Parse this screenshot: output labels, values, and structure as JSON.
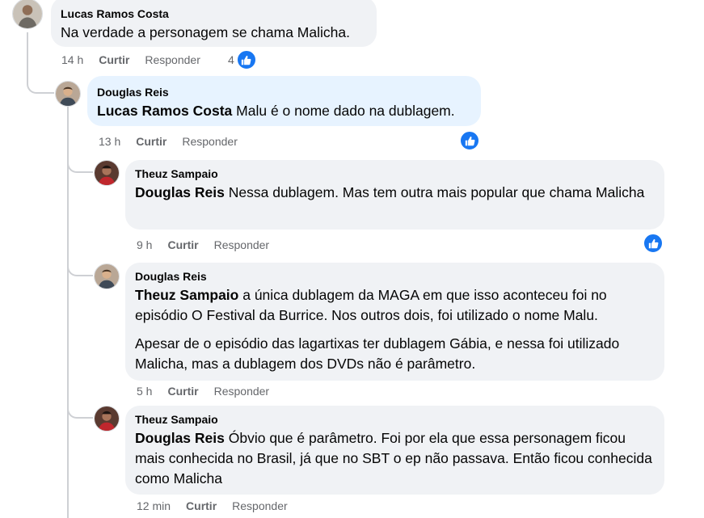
{
  "comments": [
    {
      "author": "Lucas Ramos Costa",
      "mention": "",
      "text": "Na verdade a personagem se chama Malicha.",
      "time": "14 h",
      "like_label": "Curtir",
      "reply_label": "Responder",
      "reaction_count": "4"
    },
    {
      "author": "Douglas Reis",
      "mention": "Lucas Ramos Costa",
      "text": "Malu é o nome dado na dublagem.",
      "time": "13 h",
      "like_label": "Curtir",
      "reply_label": "Responder"
    },
    {
      "author": "Theuz Sampaio",
      "mention": "Douglas Reis",
      "text": "Nessa dublagem. Mas tem outra mais popular que chama Malicha",
      "time": "9 h",
      "like_label": "Curtir",
      "reply_label": "Responder"
    },
    {
      "author": "Douglas Reis",
      "mention": "Theuz Sampaio",
      "text": "a única dublagem da MAGA em que isso aconteceu foi no episódio O Festival da Burrice. Nos outros dois, foi utilizado o nome Malu.",
      "text2": "Apesar de o episódio das lagartixas ter dublagem Gábia, e nessa foi utilizado Malicha, mas a dublagem dos DVDs não é parâmetro.",
      "time": "5 h",
      "like_label": "Curtir",
      "reply_label": "Responder"
    },
    {
      "author": "Theuz Sampaio",
      "mention": "Douglas Reis",
      "text": "Óbvio que é parâmetro. Foi por ela que essa personagem ficou mais conhecida no Brasil, já que no SBT o ep não passava. Então ficou conhecida como Malicha",
      "time": "12 min",
      "like_label": "Curtir",
      "reply_label": "Responder"
    }
  ],
  "colors": {
    "bubble": "#f0f2f5",
    "highlight_bubble": "#e7f3ff",
    "meta_text": "#65676b",
    "like_blue": "#1877f2",
    "thread_line": "#ced0d4"
  }
}
